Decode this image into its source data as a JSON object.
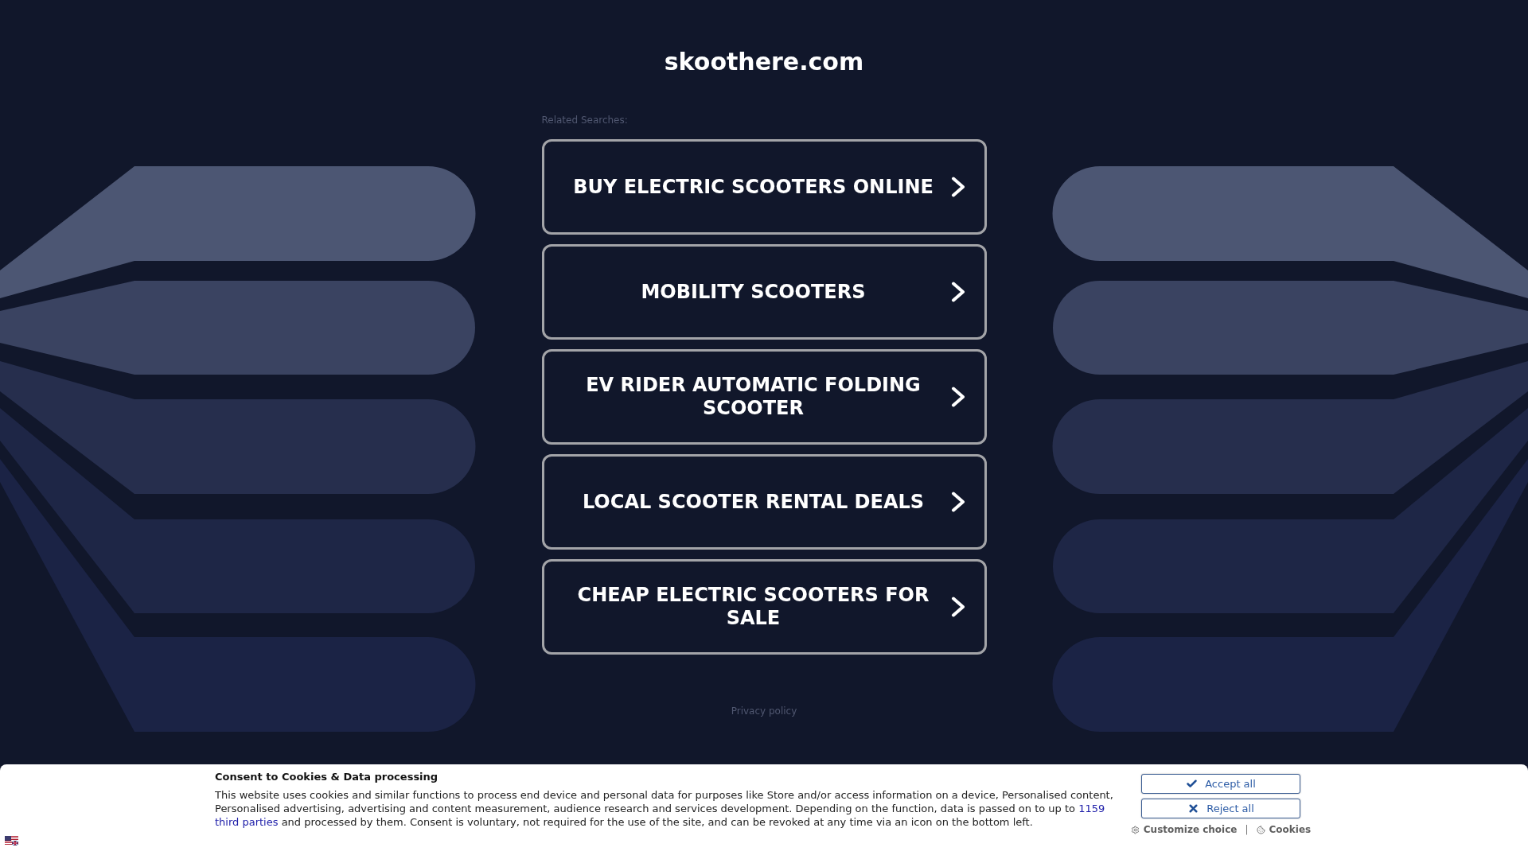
{
  "site": {
    "title": "skoothere.com"
  },
  "related_searches": {
    "label": "Related Searches:",
    "links": [
      "BUY ELECTRIC SCOOTERS ONLINE",
      "MOBILITY SCOOTERS",
      "EV RIDER AUTOMATIC FOLDING SCOOTER",
      "LOCAL SCOOTER RENTAL DEALS",
      "CHEAP ELECTRIC SCOOTERS FOR SALE"
    ]
  },
  "footer": {
    "privacy_link": "Privacy policy"
  },
  "cookie_banner": {
    "title": "Consent to Cookies & Data processing",
    "text": [
      {
        "kind": "text",
        "text": "This website uses cookies and similar functions to process end device and personal data for purposes like Store and/or access information on a device, Personalised content, Personalised advertising, advertising and content measurement, audience research and services development. Depending on the function, data is passed on to up to"
      },
      {
        "kind": "link",
        "text": "1159"
      },
      {
        "kind": "link",
        "text": "third parties"
      },
      {
        "kind": "text",
        "text": "and processed by them. Consent is voluntary, not required for the use of the site, and can be revoked at any time via an icon on the bottom left."
      }
    ],
    "buttons": [
      {
        "kind": "accept",
        "label": "Accept all"
      },
      {
        "kind": "reject",
        "label": "Reject all"
      }
    ],
    "links": [
      {
        "kind": "customize",
        "label": "Customize choice"
      },
      {
        "kind": "separator",
        "label": "|"
      },
      {
        "kind": "cookies",
        "label": "Cookies"
      }
    ]
  }
}
